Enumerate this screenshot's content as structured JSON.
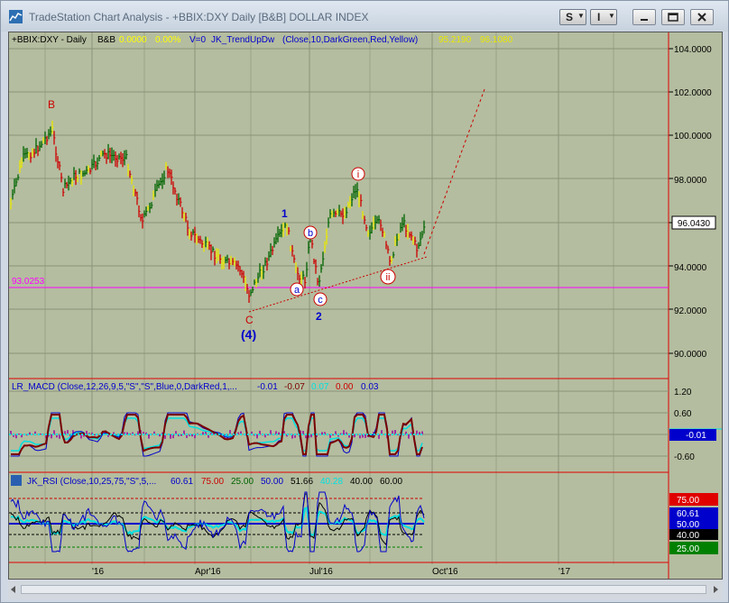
{
  "window": {
    "title": "TradeStation Chart Analysis - +BBIX:DXY Daily [B&B] DOLLAR INDEX",
    "menu_s": "S",
    "menu_i": "I"
  },
  "price_panel": {
    "symbol": "+BBIX:DXY - Daily",
    "bb": "B&B",
    "change": "0.0000",
    "change_pct": "0.00%",
    "volume": "V=0",
    "indicator": "JK_TrendUpDw",
    "indicator_params": "(Close,10,DarkGreen,Red,Yellow)",
    "value1": "95.2190",
    "value2": "96.1080",
    "last_price": "96.0430",
    "hline_label": "93.0253",
    "y_ticks": [
      "104.0000",
      "102.0000",
      "100.0000",
      "98.0000",
      "96.0000",
      "94.0000",
      "92.0000",
      "90.0000"
    ],
    "wave_labels": {
      "B": "B",
      "C": "C",
      "four": "(4)",
      "one": "1",
      "two": "2",
      "a": "a",
      "b": "b",
      "c": "c",
      "i": "i",
      "ii": "ii"
    }
  },
  "macd_panel": {
    "label": "LR_MACD (Close,12,26,9,5,\"S\",\"S\",Blue,0,DarkRed,1,...",
    "v1": "-0.01",
    "v2": "-0.07",
    "v3": "0.07",
    "v4": "0.00",
    "v5": "0.03",
    "y_ticks": [
      "1.20",
      "0.60",
      "0.00",
      "-0.60"
    ],
    "last_value": "-0.01"
  },
  "rsi_panel": {
    "label": "JK_RSI (Close,10,25,75,\"S\",5,...",
    "v1": "60.61",
    "v2": "75.00",
    "v3": "25.00",
    "v4": "50.00",
    "v5": "51.66",
    "v6": "40.28",
    "v7": "40.00",
    "v8": "60.00",
    "badges": [
      "75.00",
      "60.61",
      "50.00",
      "40.00",
      "25.00"
    ]
  },
  "x_axis": [
    "'16",
    "Apr'16",
    "Jul'16",
    "Oct'16",
    "'17"
  ],
  "colors": {
    "chart_bg": "#b4bd9f",
    "grid": "#8a9378",
    "panel_border": "#e00000",
    "bull": "#006400",
    "bear": "#cc0000",
    "neutral": "#e8e800",
    "hline": "#ff00ff",
    "macd": "#0000cc",
    "signal": "#7a0000",
    "hist": "#9b00a0",
    "cyan": "#00e0e0"
  }
}
